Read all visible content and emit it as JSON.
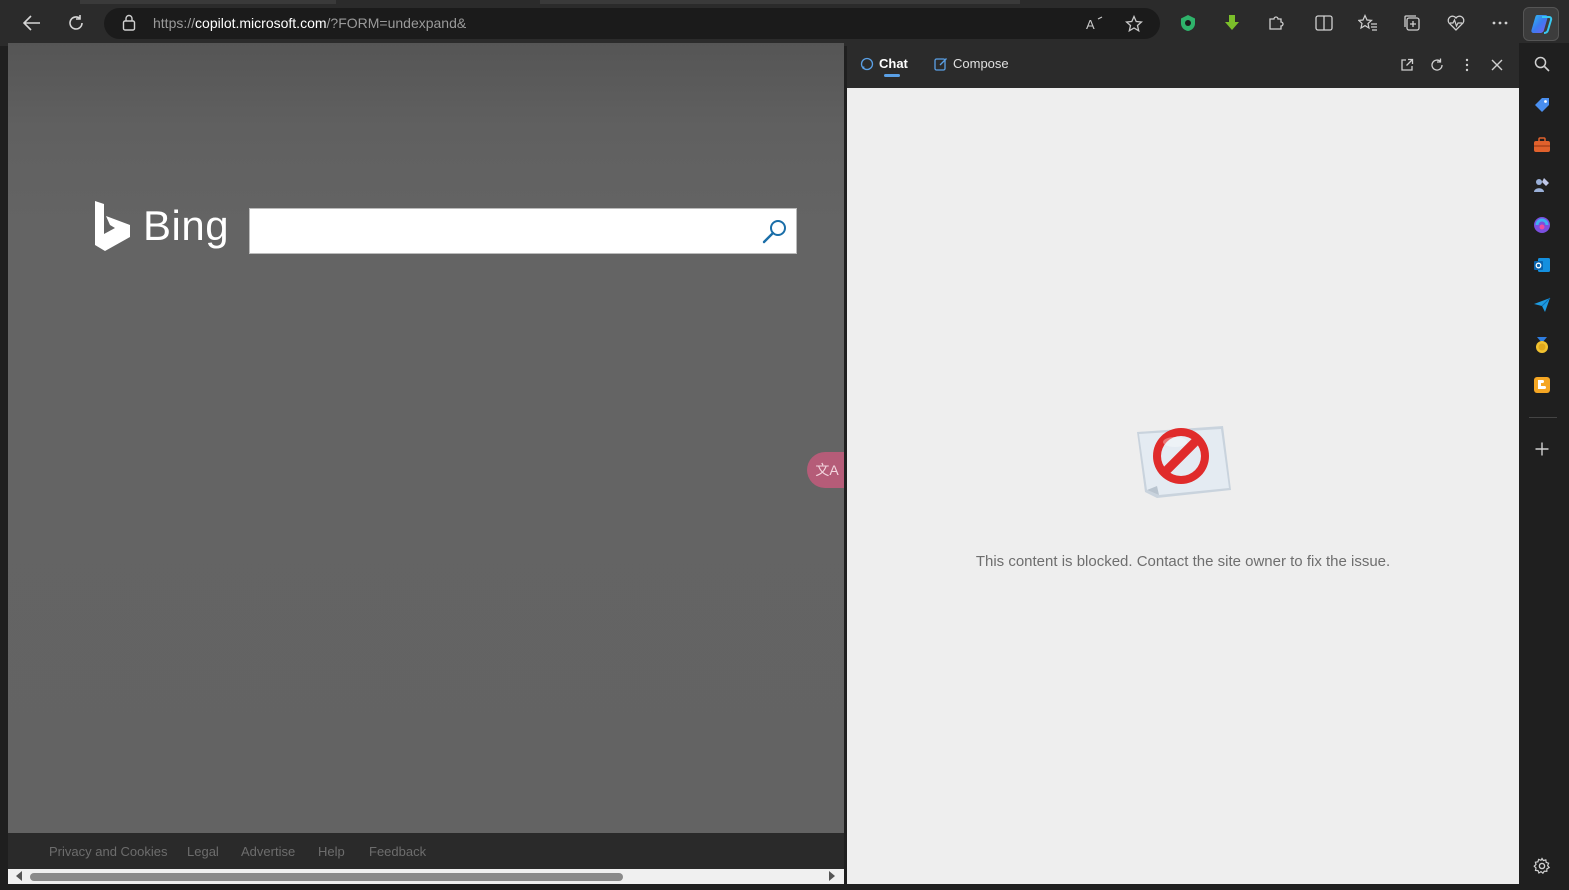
{
  "browser": {
    "url_prefix": "https://",
    "url_host": "copilot.microsoft.com",
    "url_rest": "/?FORM=undexpand&",
    "toolbar_icons": [
      "back-icon",
      "refresh-icon",
      "lock-icon",
      "read-aloud-icon",
      "favorite-star-icon",
      "extension-shield-icon",
      "download-arrow-icon",
      "extensions-puzzle-icon",
      "split-screen-icon",
      "favorites-icon",
      "collections-icon",
      "browser-essentials-icon",
      "more-icon",
      "copilot-icon"
    ]
  },
  "page": {
    "brand": "Bing",
    "search_placeholder": "",
    "footer_links": [
      "Privacy and Cookies",
      "Legal",
      "Advertise",
      "Help",
      "Feedback"
    ],
    "translate_glyph": "文A"
  },
  "side_pane": {
    "tabs": [
      {
        "label": "Chat",
        "icon": "chat-icon",
        "active": true
      },
      {
        "label": "Compose",
        "icon": "compose-icon",
        "active": false
      }
    ],
    "actions": [
      "open-in-new-tab-icon",
      "refresh-icon",
      "more-vertical-icon",
      "close-icon"
    ],
    "message": "This content is blocked. Contact the site owner to fix the issue."
  },
  "sidebar": {
    "items": [
      "search-icon",
      "shopping-tag-icon",
      "tools-briefcase-icon",
      "games-icon",
      "microsoft-365-icon",
      "outlook-icon",
      "send-icon",
      "rewards-medal-icon",
      "blogger-icon",
      "add-icon",
      "settings-icon"
    ]
  },
  "colors": {
    "accent": "#5aa0e6",
    "page_bg": "#636363",
    "pane_bg": "#eeeeee",
    "blocked_red": "#e02b2b"
  }
}
